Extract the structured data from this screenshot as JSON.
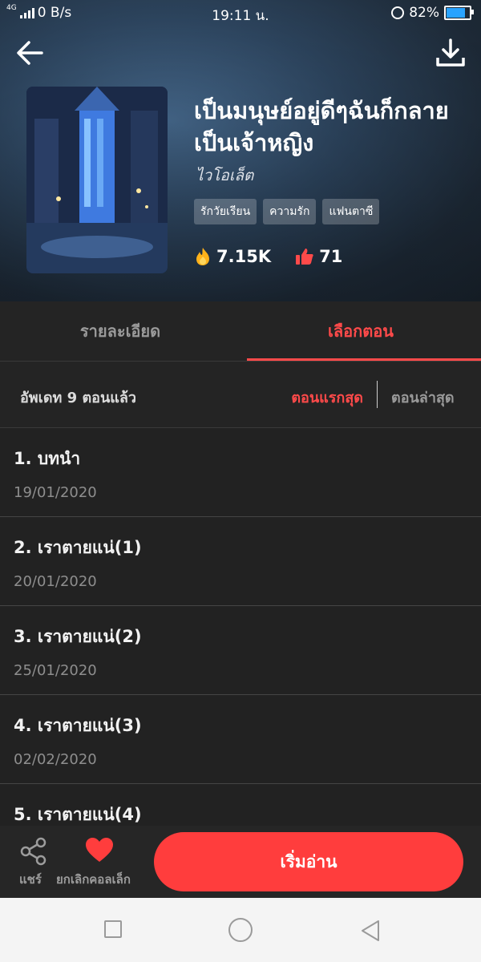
{
  "status_bar": {
    "network_type": "4G",
    "speed": "0 B/s",
    "time": "19:11 น.",
    "battery_percent": "82%",
    "battery_level": 0.82
  },
  "header": {
    "back_icon": "arrow-left-icon",
    "download_icon": "download-icon",
    "title": "เป็นมนุษย์อยู่ดีๆฉันก็กลายเป็นเจ้าหญิง",
    "author": "ไวโอเล็ต",
    "tags": [
      "รักวัยเรียน",
      "ความรัก",
      "แฟนตาซี"
    ],
    "views": "7.15K",
    "likes": "71"
  },
  "tabs": {
    "details": "รายละเอียด",
    "episodes": "เลือกตอน"
  },
  "episode_list": {
    "update_text": "อัพเดท 9 ตอนแล้ว",
    "sort_first": "ตอนแรกสุด",
    "sort_latest": "ตอนล่าสุด",
    "items": [
      {
        "title": "1. บทนำ",
        "date": "19/01/2020"
      },
      {
        "title": "2. เราตายแน่(1)",
        "date": "20/01/2020"
      },
      {
        "title": "3. เราตายแน่(2)",
        "date": "25/01/2020"
      },
      {
        "title": "4. เราตายแน่(3)",
        "date": "02/02/2020"
      },
      {
        "title": "5. เราตายแน่(4)",
        "date": ""
      }
    ]
  },
  "bottom_bar": {
    "share_label": "แชร์",
    "uncollect_label": "ยกเลิกคอลเล็ก",
    "read_button": "เริ่มอ่าน"
  },
  "colors": {
    "accent": "#ff3d3d",
    "background": "#222222"
  }
}
